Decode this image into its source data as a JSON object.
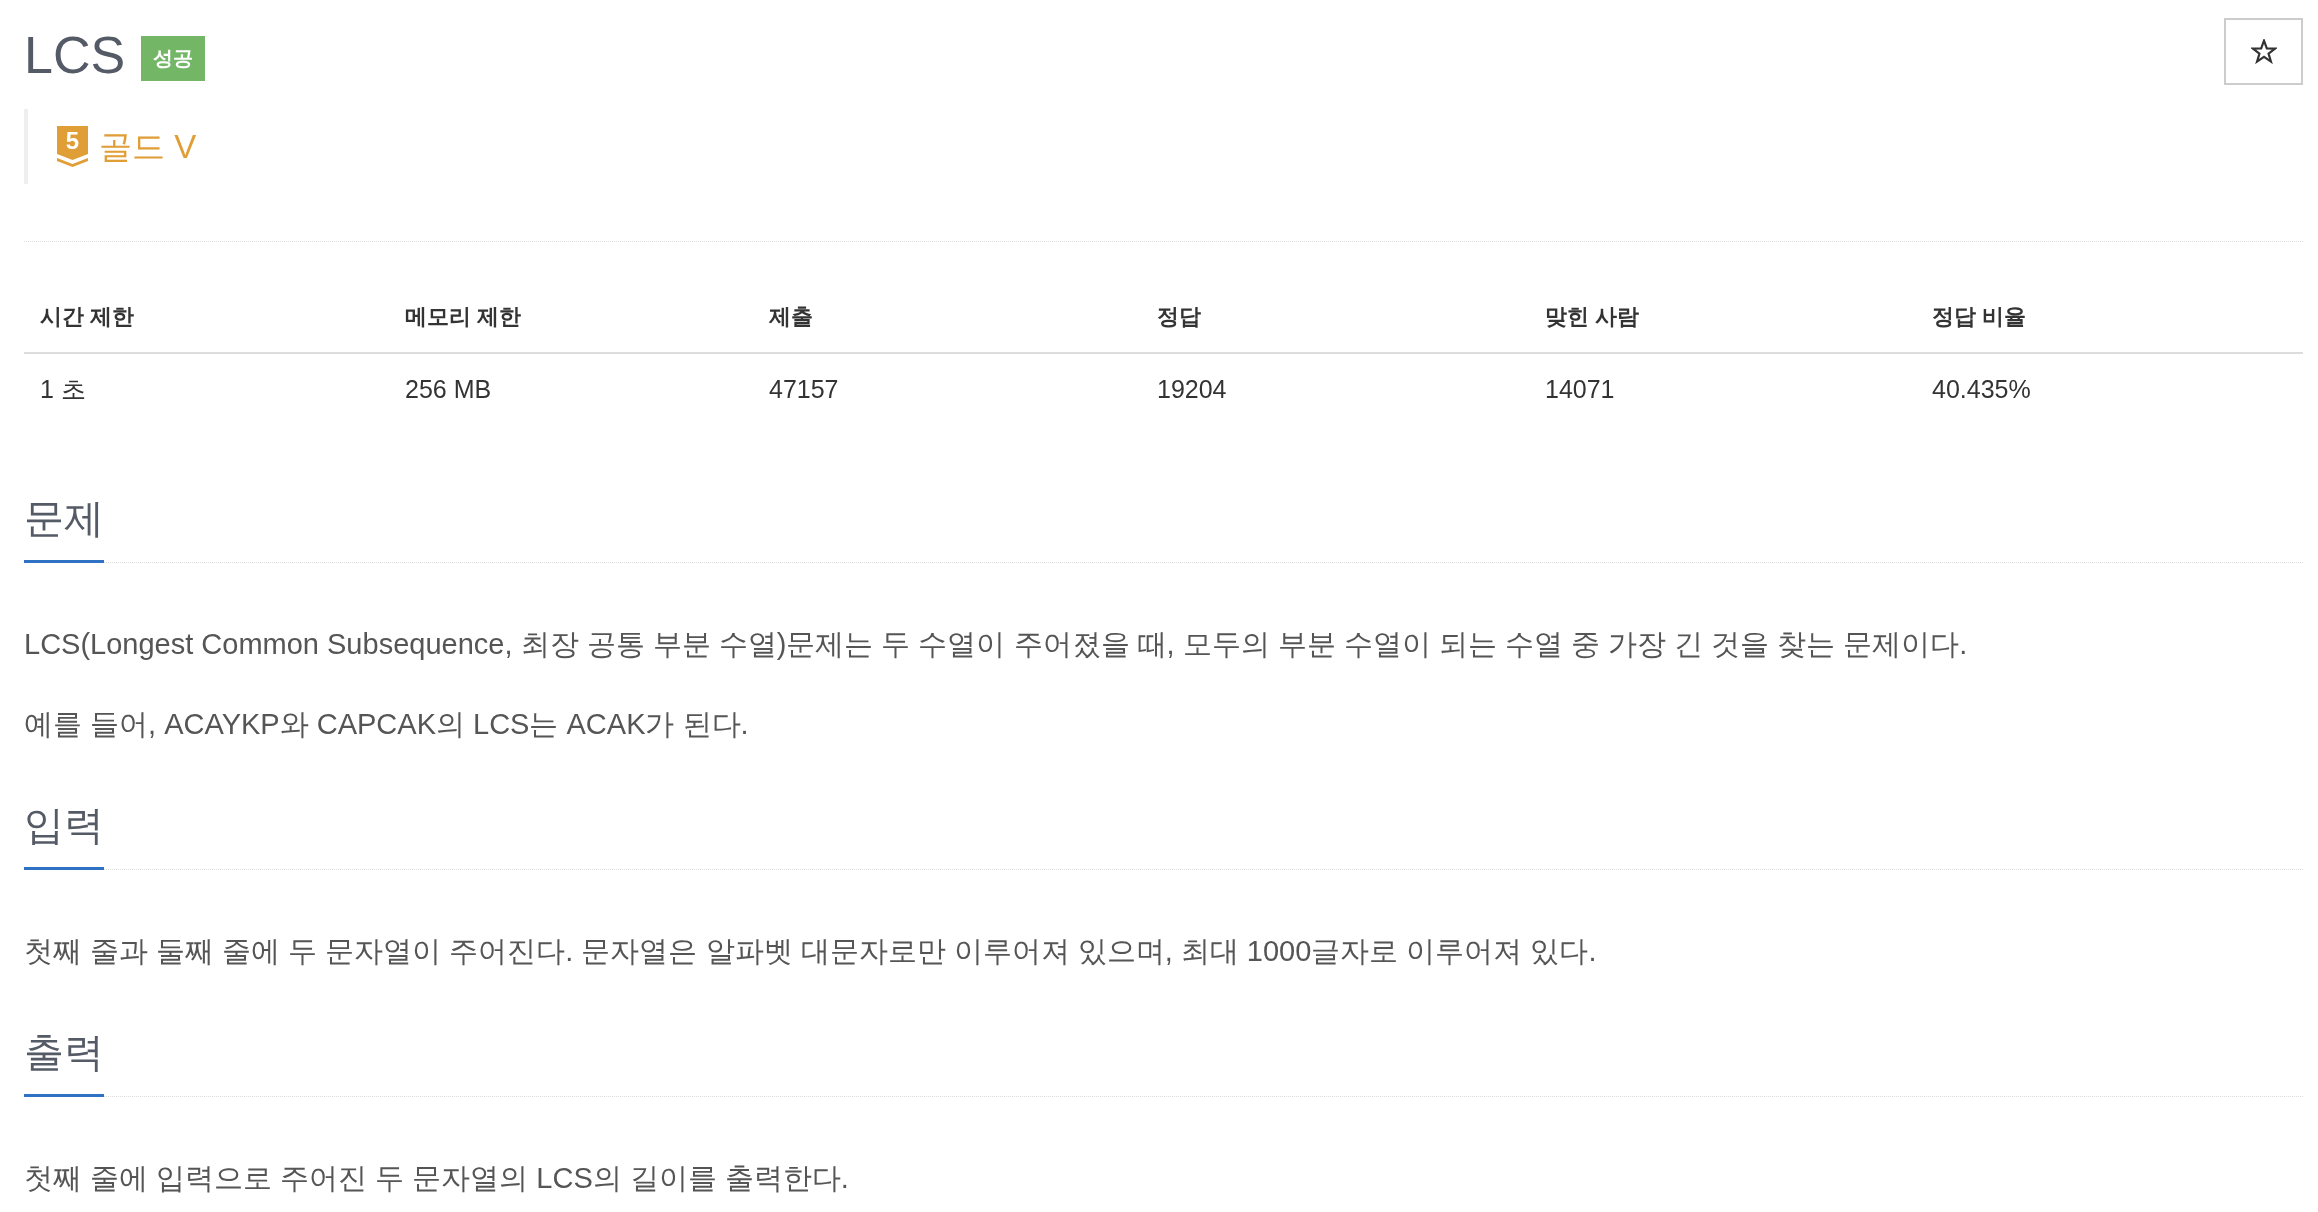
{
  "problem": {
    "title": "LCS",
    "result_badge": "성공",
    "tier": {
      "number": "5",
      "label": "골드 V"
    }
  },
  "stats_table": {
    "columns": [
      "시간 제한",
      "메모리 제한",
      "제출",
      "정답",
      "맞힌 사람",
      "정답 비율"
    ],
    "rows": [
      [
        "1 초",
        "256 MB",
        "47157",
        "19204",
        "14071",
        "40.435%"
      ]
    ]
  },
  "sections": [
    {
      "heading": "문제",
      "paragraphs": [
        "LCS(Longest Common Subsequence, 최장 공통 부분 수열)문제는 두 수열이 주어졌을 때, 모두의 부분 수열이 되는 수열 중 가장 긴 것을 찾는 문제이다.",
        "예를 들어, ACAYKP와 CAPCAK의 LCS는 ACAK가 된다."
      ]
    },
    {
      "heading": "입력",
      "paragraphs": [
        "첫째 줄과 둘째 줄에 두 문자열이 주어진다. 문자열은 알파벳 대문자로만 이루어져 있으며, 최대 1000글자로 이루어져 있다."
      ]
    },
    {
      "heading": "출력",
      "paragraphs": [
        "첫째 줄에 입력으로 주어진 두 문자열의 LCS의 길이를 출력한다."
      ]
    }
  ]
}
